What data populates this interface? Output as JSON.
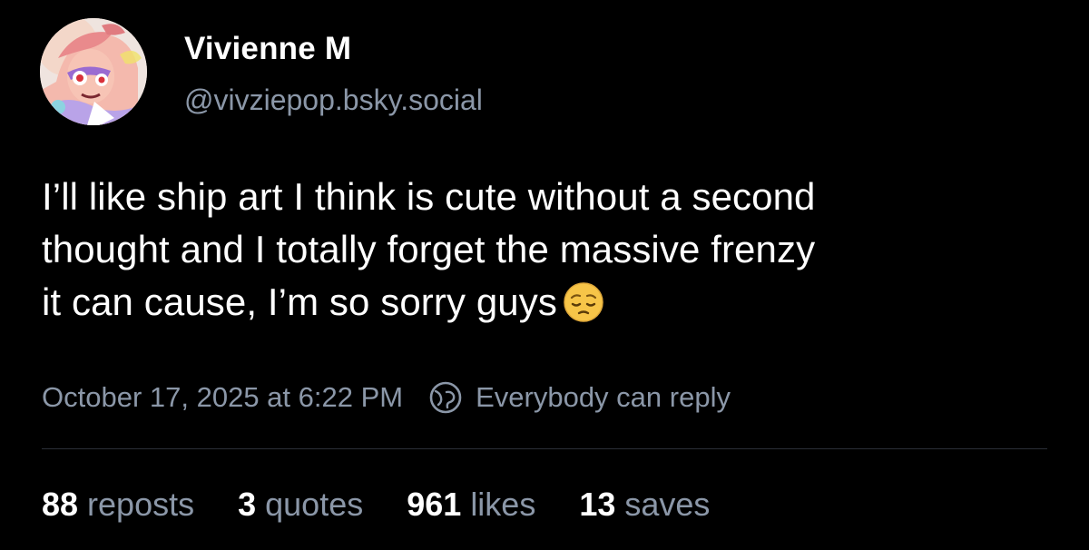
{
  "author": {
    "display_name": "Vivienne M",
    "handle": "@vivziepop.bsky.social",
    "avatar_icon": "avatar-image"
  },
  "post": {
    "text_lines": [
      "I’ll like ship art I think is cute without a second",
      "thought and I totally forget the massive frenzy",
      "it can cause, I’m so sorry guys"
    ],
    "emoji": "pensive-face-emoji",
    "timestamp": "October 17, 2025 at 6:22 PM",
    "reply_setting": "Everybody can reply",
    "reply_icon": "globe-icon"
  },
  "stats": {
    "reposts": {
      "count": "88",
      "label": "reposts"
    },
    "quotes": {
      "count": "3",
      "label": "quotes"
    },
    "likes": {
      "count": "961",
      "label": "likes"
    },
    "saves": {
      "count": "13",
      "label": "saves"
    }
  },
  "colors": {
    "background": "#000000",
    "text": "#ffffff",
    "muted": "#8b97a8",
    "divider": "#2a2f37"
  }
}
